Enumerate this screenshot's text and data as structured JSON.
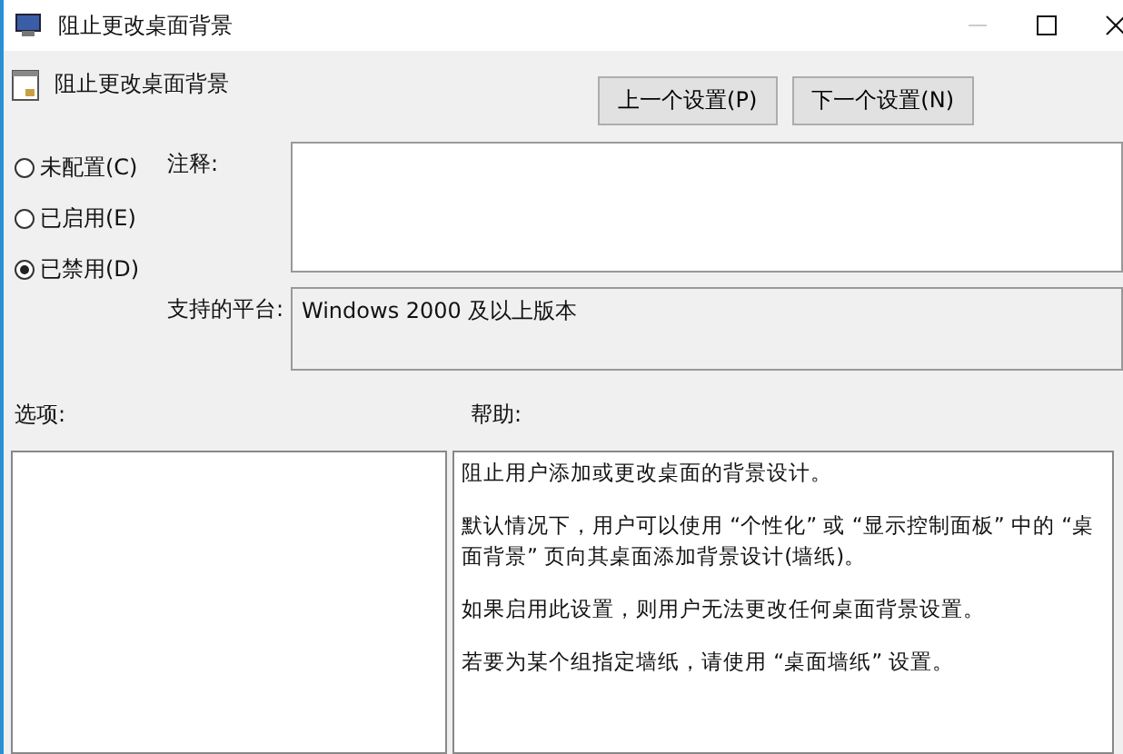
{
  "window": {
    "title": "阻止更改桌面背景"
  },
  "header": {
    "title": "阻止更改桌面背景"
  },
  "nav_buttons": [
    "上一个设置(P)",
    "下一个设置(N)"
  ],
  "state_options": [
    {
      "label": "未配置(C)",
      "selected": false
    },
    {
      "label": "已启用(E)",
      "selected": false
    },
    {
      "label": "已禁用(D)",
      "selected": true
    }
  ],
  "comment": {
    "label": "注释:"
  },
  "platform": {
    "label": "支持的平台:",
    "value": "Windows 2000 及以上版本"
  },
  "options": {
    "label": "选项:"
  },
  "help": {
    "label": "帮助:",
    "paragraphs": [
      "阻止用户添加或更改桌面的背景设计。",
      "默认情况下，用户可以使用 “个性化” 或 “显示控制面板” 中的 “桌面背景” 页向其桌面添加背景设计(墙纸)。",
      "如果启用此设置，则用户无法更改任何桌面背景设置。",
      "若要为某个组指定墙纸，请使用 “桌面墙纸” 设置。"
    ]
  }
}
